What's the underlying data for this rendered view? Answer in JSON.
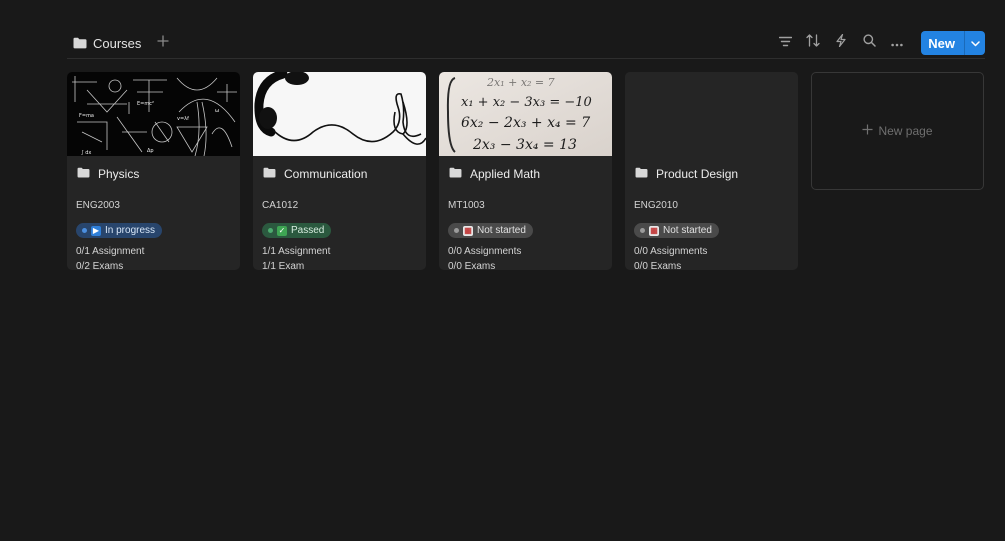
{
  "toolbar": {
    "view_name": "Courses",
    "new_label": "New",
    "icons": [
      "folder-icon",
      "plus-icon",
      "filter-icon",
      "sort-icon",
      "lightning-icon",
      "search-icon",
      "more-icon",
      "chevron-down-icon"
    ]
  },
  "cards": [
    {
      "title": "Physics",
      "code": "ENG2003",
      "status": "In progress",
      "status_emoji": "▶",
      "assignments": "0/1 Assignment",
      "exams": "0/2 Exams"
    },
    {
      "title": "Communication",
      "code": "CA1012",
      "status": "Passed",
      "status_emoji": "✓",
      "assignments": "1/1 Assignment",
      "exams": "1/1 Exam"
    },
    {
      "title": "Applied Math",
      "code": "MT1003",
      "status": "Not started",
      "status_emoji": "▦",
      "assignments": "0/0 Assignments",
      "exams": "0/0 Exams"
    },
    {
      "title": "Product Design",
      "code": "ENG2010",
      "status": "Not started",
      "status_emoji": "▦",
      "assignments": "0/0 Assignments",
      "exams": "0/0 Exams"
    }
  ],
  "new_page_label": "New page",
  "colors": {
    "background": "#191919",
    "card": "#252525",
    "accent": "#2383e2",
    "in_progress": "#28456c",
    "passed": "#2b593f",
    "not_started": "#4a4a4a"
  }
}
